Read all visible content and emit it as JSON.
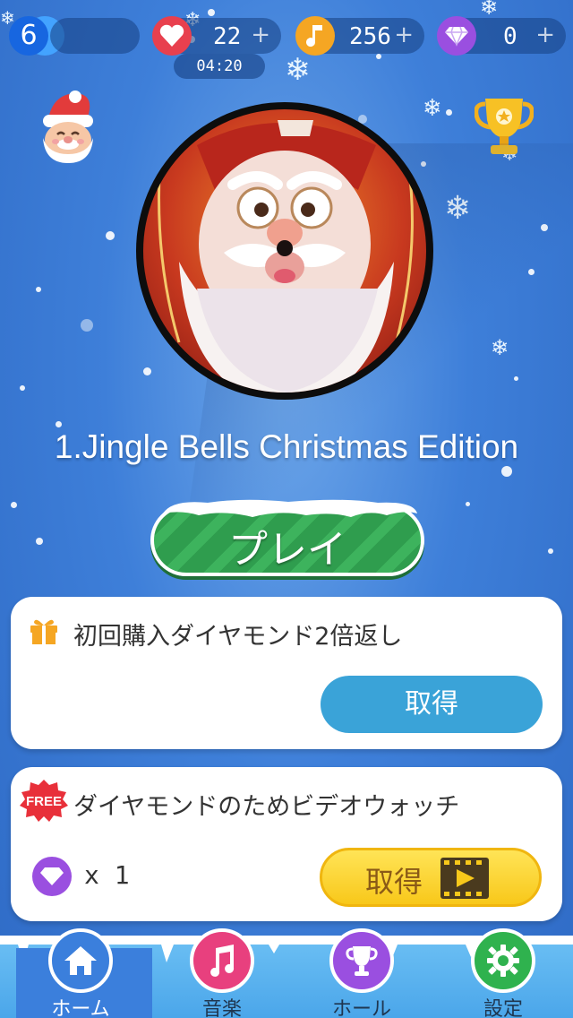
{
  "top_bar": {
    "level": "6",
    "lives": {
      "value": "22",
      "plus": "+",
      "timer": "04:20"
    },
    "notes": {
      "value": "256",
      "plus": "+"
    },
    "diamonds": {
      "value": "0",
      "plus": "+"
    }
  },
  "song": {
    "title": "1.Jingle Bells Christmas Edition"
  },
  "play_button": {
    "label": "プレイ"
  },
  "offer_card": {
    "title": "初回購入ダイヤモンド2倍返し",
    "button_label": "取得"
  },
  "video_card": {
    "free_badge": "FREE",
    "title": "ダイヤモンドのためビデオウォッチ",
    "reward_text": "x 1",
    "button_label": "取得"
  },
  "bottom_nav": {
    "items": [
      {
        "label": "ホーム",
        "icon": "home-icon"
      },
      {
        "label": "音楽",
        "icon": "music-note-icon"
      },
      {
        "label": "ホール",
        "icon": "trophy-icon"
      },
      {
        "label": "設定",
        "icon": "gear-icon"
      }
    ]
  },
  "colors": {
    "background": "#3e7fd9",
    "play_green": "#2f9d4e",
    "get_blue": "#3aa3d8",
    "get_yellow": "#f8c81a",
    "heart_red": "#e8404e",
    "note_orange": "#f5a623",
    "diamond_purple": "#9a4fe0"
  }
}
